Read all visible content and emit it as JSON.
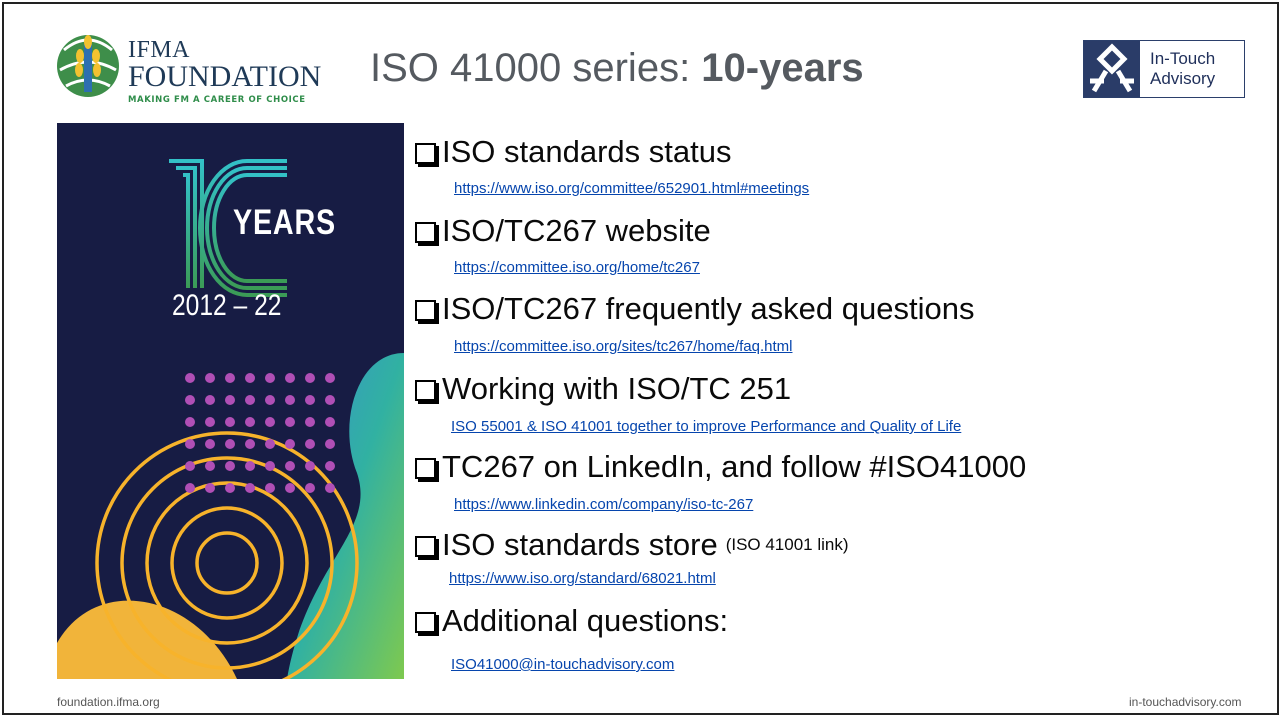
{
  "header": {
    "title_regular": "ISO 41000 series: ",
    "title_bold": "10-years",
    "ifma_logo": {
      "line1": "IFMA",
      "line2": "FOUNDATION",
      "tagline": "MAKING FM A CAREER OF CHOICE",
      "icon": "globe-wheat-icon"
    },
    "ita_logo": {
      "line1": "In-Touch",
      "line2": "Advisory",
      "icon": "figure-icon"
    }
  },
  "poster": {
    "years_word": "YEARS",
    "range": "2012 – 22",
    "big_number": "10"
  },
  "items": [
    {
      "heading": "ISO standards status",
      "link": "https://www.iso.org/committee/652901.html#meetings"
    },
    {
      "heading": "ISO/TC267 website",
      "link": "https://committee.iso.org/home/tc267"
    },
    {
      "heading": "ISO/TC267 frequently asked questions",
      "link": "https://committee.iso.org/sites/tc267/home/faq.html"
    },
    {
      "heading": "Working with ISO/TC 251",
      "link": "ISO 55001 & ISO 41001 together to improve Performance and Quality of Life"
    },
    {
      "heading": "TC267 on LinkedIn, and follow #ISO41000",
      "link": "https://www.linkedin.com/company/iso-tc-267"
    },
    {
      "heading": "ISO standards store",
      "note": "(ISO 41001 link)",
      "link": "https://www.iso.org/standard/68021.html"
    },
    {
      "heading": "Additional questions:",
      "link": "ISO41000@in-touchadvisory.com"
    }
  ],
  "footer": {
    "left": "foundation.ifma.org",
    "right": "in-touchadvisory.com"
  },
  "colors": {
    "poster_bg": "#171c44",
    "link": "#0645ad",
    "title": "#555a60"
  }
}
